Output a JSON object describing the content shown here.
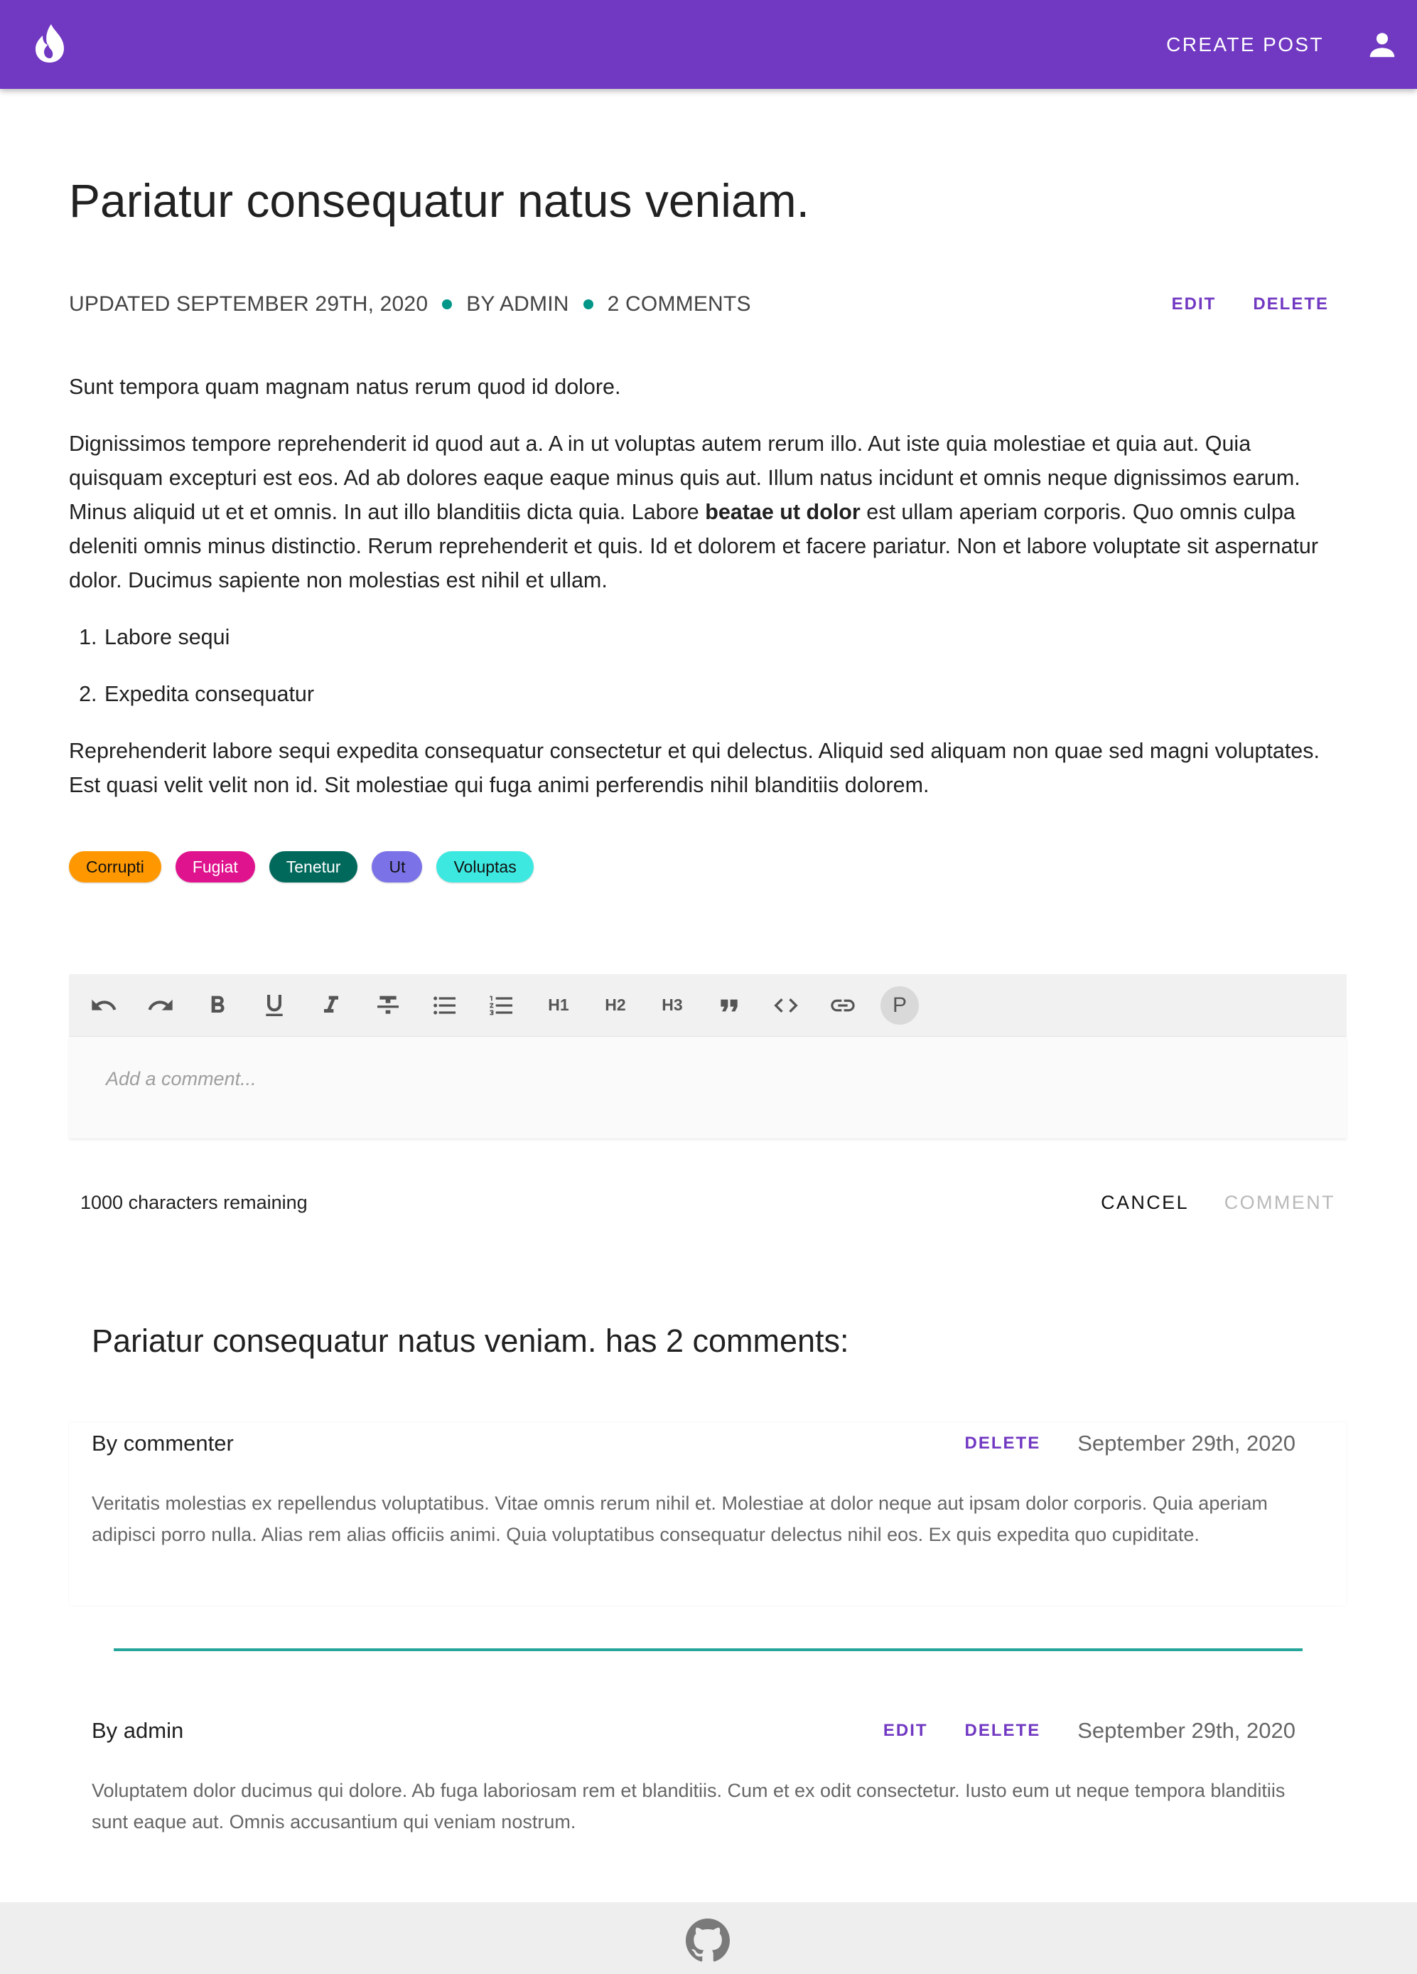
{
  "header": {
    "create_post_label": "CREATE POST",
    "brand_color": "#7138c2",
    "logo_icon": "flame-icon",
    "account_icon": "account-icon"
  },
  "post": {
    "title": "Pariatur consequatur natus veniam.",
    "updated": "UPDATED SEPTEMBER 29TH, 2020",
    "author": "BY ADMIN",
    "comment_count": "2 COMMENTS",
    "edit_label": "EDIT",
    "delete_label": "DELETE",
    "body": {
      "para1": "Sunt tempora quam magnam natus rerum quod id dolore.",
      "para2_before": "Dignissimos tempore reprehenderit id quod aut a. A in ut voluptas autem rerum illo. Aut iste quia molestiae et quia aut. Quia quisquam excepturi est eos. Ad ab dolores eaque eaque minus quis aut. Illum natus incidunt et omnis neque dignissimos earum. Minus aliquid ut et et omnis. In aut illo blanditiis dicta quia. Labore ",
      "para2_bold": "beatae ut dolor",
      "para2_after": " est ullam aperiam corporis. Quo omnis culpa deleniti omnis minus distinctio. Rerum reprehenderit et quis. Id et dolorem et facere pariatur. Non et labore voluptate sit aspernatur dolor. Ducimus sapiente non molestias est nihil et ullam.",
      "list": [
        "Labore sequi",
        "Expedita consequatur"
      ],
      "para3": "Reprehenderit labore sequi expedita consequatur consectetur et qui delectus. Aliquid sed aliquam non quae sed magni voluptates. Est quasi velit velit non id. Sit molestiae qui fuga animi perferendis nihil blanditiis dolorem."
    },
    "tags": [
      {
        "label": "Corrupti",
        "bg": "#ff9800",
        "fg": "#111111"
      },
      {
        "label": "Fugiat",
        "bg": "#e0138e",
        "fg": "#ffffff"
      },
      {
        "label": "Tenetur",
        "bg": "#00695c",
        "fg": "#ffffff"
      },
      {
        "label": "Ut",
        "bg": "#7b72e8",
        "fg": "#111111"
      },
      {
        "label": "Voluptas",
        "bg": "#3de8e0",
        "fg": "#111111"
      }
    ]
  },
  "editor": {
    "toolbar": {
      "undo_icon": "undo-icon",
      "redo_icon": "redo-icon",
      "bold_icon": "bold-icon",
      "underline_icon": "underline-icon",
      "italic_icon": "italic-icon",
      "strikethrough_icon": "strikethrough-icon",
      "bullet_list_icon": "bullet-list-icon",
      "numbered_list_icon": "numbered-list-icon",
      "h1": "H1",
      "h2": "H2",
      "h3": "H3",
      "quote_icon": "quote-icon",
      "code_icon": "code-icon",
      "link_icon": "link-icon",
      "paragraph": "P"
    },
    "placeholder": "Add a comment...",
    "remaining": "1000 characters remaining",
    "cancel_label": "CANCEL",
    "comment_label": "COMMENT"
  },
  "comments": {
    "heading": "Pariatur consequatur natus veniam. has 2 comments:",
    "items": [
      {
        "author": "By commenter",
        "delete_label": "DELETE",
        "date": "September 29th, 2020",
        "text": "Veritatis molestias ex repellendus voluptatibus. Vitae omnis rerum nihil et. Molestiae at dolor neque aut ipsam dolor corporis. Quia aperiam adipisci porro nulla. Alias rem alias officiis animi. Quia voluptatibus consequatur delectus nihil eos. Ex quis expedita quo cupiditate."
      },
      {
        "author": "By admin",
        "edit_label": "EDIT",
        "delete_label": "DELETE",
        "date": "September 29th, 2020",
        "text": "Voluptatem dolor ducimus qui dolore. Ab fuga laboriosam rem et blanditiis. Cum et ex odit consectetur. Iusto eum ut neque tempora blanditiis sunt eaque aut. Omnis accusantium qui veniam nostrum."
      }
    ],
    "divider_color": "#26a69a"
  },
  "footer": {
    "github_icon": "github-icon"
  }
}
